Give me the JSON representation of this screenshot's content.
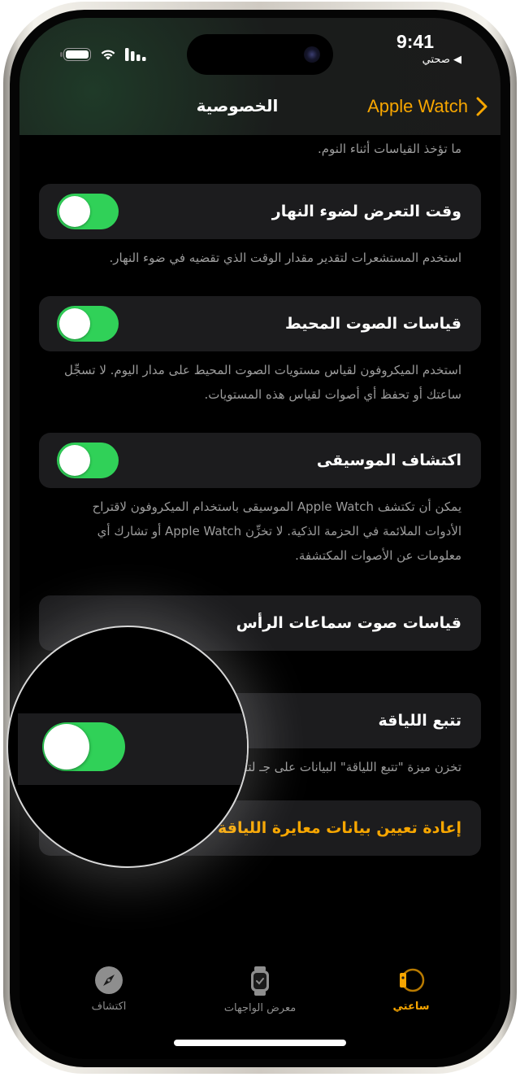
{
  "status_bar": {
    "time": "9:41",
    "back_app": "◀ صحتي",
    "icons": [
      "battery-icon",
      "wifi-icon",
      "cellular-signal-icon"
    ]
  },
  "nav": {
    "title": "الخصوصية",
    "back_label": "Apple Watch",
    "back_icon": "chevron-right-icon"
  },
  "content": {
    "top_desc": "ما تؤخذ القياسات أثناء النوم.",
    "items": [
      {
        "label": "وقت التعرض لضوء النهار",
        "toggle_on": true,
        "desc": "استخدم المستشعرات لتقدير مقدار الوقت الذي تقضيه في ضوء النهار."
      },
      {
        "label": "قياسات الصوت المحيط",
        "toggle_on": true,
        "desc": "استخدم الميكروفون لقياس مستويات الصوت المحيط على مدار اليوم. لا تسجِّل ساعتك أو تحفظ أي أصوات لقياس هذه المستويات."
      },
      {
        "label": "اكتشاف الموسيقى",
        "toggle_on": true,
        "desc": "يمكن أن تكتشف Apple Watch الموسيقى باستخدام الميكروفون لاقتراح الأدوات الملائمة في الحزمة الذكية. لا تخزِّن Apple Watch أو تشارك أي معلومات عن الأصوات المكتشفة."
      },
      {
        "label": "قياسات صوت سماعات الرأس"
      },
      {
        "label": "تتبع اللياقة",
        "toggle_on": true,
        "desc": "تخزن ميزة \"تتبع اللياقة\" البيانات على جـ لتقدير حركتك وتحركاتك وعدد خطواتك و"
      }
    ],
    "reset_action": "إعادة تعيين بيانات معايرة اللياقة"
  },
  "tabbar": {
    "tabs": [
      {
        "label": "ساعتي",
        "icon": "my-watch-icon",
        "active": true
      },
      {
        "label": "معرض الواجهات",
        "icon": "watch-face-icon",
        "active": false
      },
      {
        "label": "اكتشاف",
        "icon": "compass-icon",
        "active": false
      }
    ]
  },
  "colors": {
    "accent": "#f7a600",
    "toggle_on": "#30d158",
    "cell_bg": "#1c1c1e",
    "secondary_text": "#9c9c9c"
  }
}
